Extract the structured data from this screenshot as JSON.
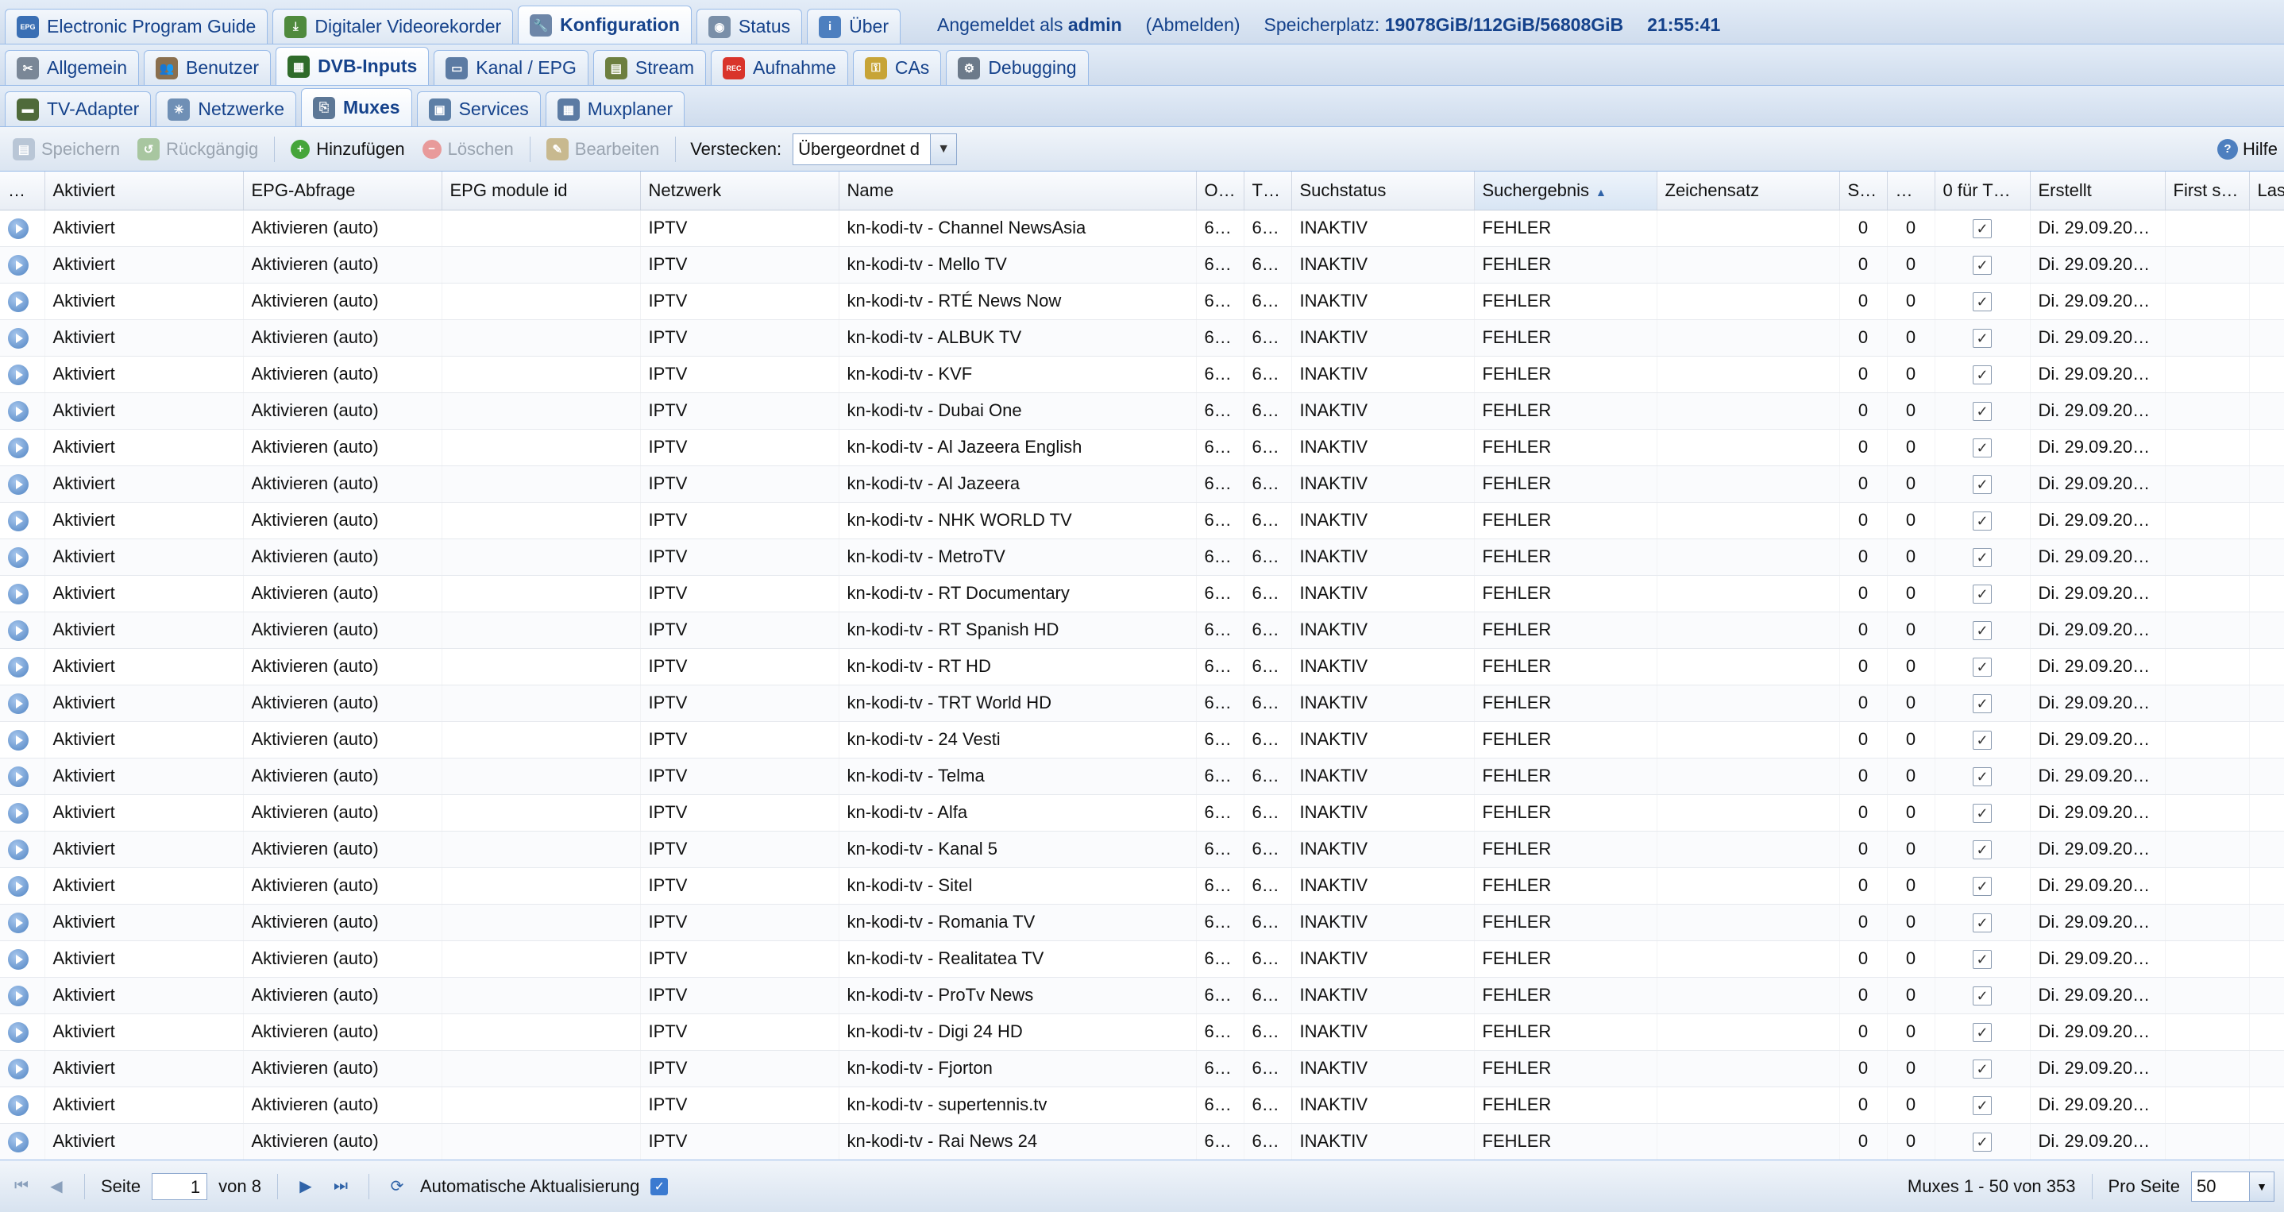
{
  "colors": {
    "accent": "#15428b",
    "border": "#99bbe8",
    "rec": "#d9342b"
  },
  "top_tabs": [
    {
      "label": "Electronic Program Guide",
      "icon": "epg-icon",
      "glyph": "EPG",
      "bg": "#3a6fb4"
    },
    {
      "label": "Digitaler Videorekorder",
      "icon": "download-icon",
      "glyph": "⤓",
      "bg": "#4f8a3d"
    },
    {
      "label": "Konfiguration",
      "icon": "wrench-icon",
      "glyph": "🔧",
      "bg": "#6d86a8",
      "active": true
    },
    {
      "label": "Status",
      "icon": "eye-icon",
      "glyph": "◉",
      "bg": "#7a8fa8"
    },
    {
      "label": "Über",
      "icon": "info-icon",
      "glyph": "i",
      "bg": "#4d7fbf"
    }
  ],
  "session": {
    "logged_in_prefix": "Angemeldet als",
    "user": "admin",
    "logout": "(Abmelden)",
    "storage_label": "Speicherplatz:",
    "storage_value": "19078GiB/112GiB/56808GiB",
    "time": "21:55:41"
  },
  "config_tabs": [
    {
      "label": "Allgemein",
      "icon": "tools-icon",
      "glyph": "✂",
      "bg": "#7a8797"
    },
    {
      "label": "Benutzer",
      "icon": "users-icon",
      "glyph": "👥",
      "bg": "#8a6f4e"
    },
    {
      "label": "DVB-Inputs",
      "icon": "dvb-card-icon",
      "glyph": "▦",
      "bg": "#2f6b2a",
      "active": true
    },
    {
      "label": "Kanal / EPG",
      "icon": "tv-icon",
      "glyph": "▭",
      "bg": "#5c7ba3"
    },
    {
      "label": "Stream",
      "icon": "stream-icon",
      "glyph": "▤",
      "bg": "#6d7f3f"
    },
    {
      "label": "Aufnahme",
      "icon": "rec-icon",
      "glyph": "REC",
      "bg": "#d9342b"
    },
    {
      "label": "CAs",
      "icon": "key-icon",
      "glyph": "⚿",
      "bg": "#c7a437"
    },
    {
      "label": "Debugging",
      "icon": "debug-icon",
      "glyph": "⚙",
      "bg": "#6c7a8a"
    }
  ],
  "dvb_tabs": [
    {
      "label": "TV-Adapter",
      "icon": "adapter-icon",
      "glyph": "▬",
      "bg": "#4f6a3a"
    },
    {
      "label": "Netzwerke",
      "icon": "antenna-icon",
      "glyph": "✳",
      "bg": "#6f8fb5"
    },
    {
      "label": "Muxes",
      "icon": "mux-icon",
      "glyph": "⎘",
      "bg": "#5c7796",
      "active": true
    },
    {
      "label": "Services",
      "icon": "services-icon",
      "glyph": "▣",
      "bg": "#5d7fa6"
    },
    {
      "label": "Muxplaner",
      "icon": "calendar-icon",
      "glyph": "▦",
      "bg": "#5c7ba3"
    }
  ],
  "toolbar": {
    "save": "Speichern",
    "undo": "Rückgängig",
    "add": "Hinzufügen",
    "delete": "Löschen",
    "edit": "Bearbeiten",
    "hide_label": "Verstecken:",
    "hide_value": "Übergeordnet d",
    "help": "Hilfe"
  },
  "columns": [
    "…",
    "Aktiviert",
    "EPG-Abfrage",
    "EPG module id",
    "Netzwerk",
    "Name",
    "O…",
    "T…",
    "Suchstatus",
    "Suchergebnis",
    "Zeichensatz",
    "S…",
    "…",
    "0 für T…",
    "Erstellt",
    "First s…",
    "Last s…"
  ],
  "row_common": {
    "enabled": "Aktiviert",
    "epg": "Aktivieren (auto)",
    "epg_module": "",
    "network": "IPTV",
    "o": "6…",
    "t": "6…",
    "scan_status": "INAKTIV",
    "scan_result": "FEHLER",
    "charset": "",
    "s": "0",
    "dots": "0",
    "created": "Di. 29.09.20…",
    "first_seen": "",
    "last_seen": ""
  },
  "rows": [
    "kn-kodi-tv - Channel NewsAsia",
    "kn-kodi-tv - Mello TV",
    "kn-kodi-tv - RTÉ News Now",
    "kn-kodi-tv - ALBUK TV",
    "kn-kodi-tv - KVF",
    "kn-kodi-tv - Dubai One",
    "kn-kodi-tv - Al Jazeera English",
    "kn-kodi-tv - Al Jazeera",
    "kn-kodi-tv - NHK WORLD TV",
    "kn-kodi-tv - MetroTV",
    "kn-kodi-tv - RT Documentary",
    "kn-kodi-tv - RT Spanish HD",
    "kn-kodi-tv - RT HD",
    "kn-kodi-tv - TRT World HD",
    "kn-kodi-tv - 24 Vesti",
    "kn-kodi-tv - Telma",
    "kn-kodi-tv - Alfa",
    "kn-kodi-tv - Kanal 5",
    "kn-kodi-tv - Sitel",
    "kn-kodi-tv - Romania TV",
    "kn-kodi-tv - Realitatea TV",
    "kn-kodi-tv - ProTv News",
    "kn-kodi-tv - Digi 24 HD",
    "kn-kodi-tv - Fjorton",
    "kn-kodi-tv - supertennis.tv",
    "kn-kodi-tv - Rai News 24"
  ],
  "paging": {
    "page_label": "Seite",
    "page_value": "1",
    "of_label": "von 8",
    "auto_refresh": "Automatische Aktualisierung",
    "summary": "Muxes 1 - 50 von 353",
    "per_page_label": "Pro Seite",
    "per_page_value": "50"
  }
}
